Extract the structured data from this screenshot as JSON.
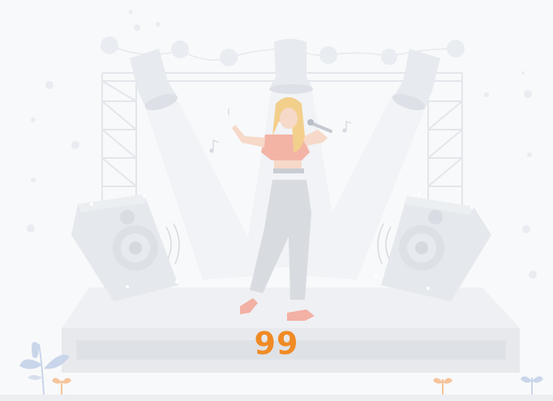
{
  "countdown": {
    "value": "99"
  },
  "illustration": {
    "subject": "singer-on-stage",
    "icon": "stage-illustration"
  },
  "colors": {
    "background": "#f8f9fa",
    "stage_gray": "#e7e9ed",
    "light_gray": "#eef0f3",
    "counter_orange": "#f08a24",
    "hair_yellow": "#f4cf8e",
    "shirt_pink": "#f6b3a6",
    "plant_blue": "#c9d5ea",
    "plant_orange": "#f6c49a"
  }
}
